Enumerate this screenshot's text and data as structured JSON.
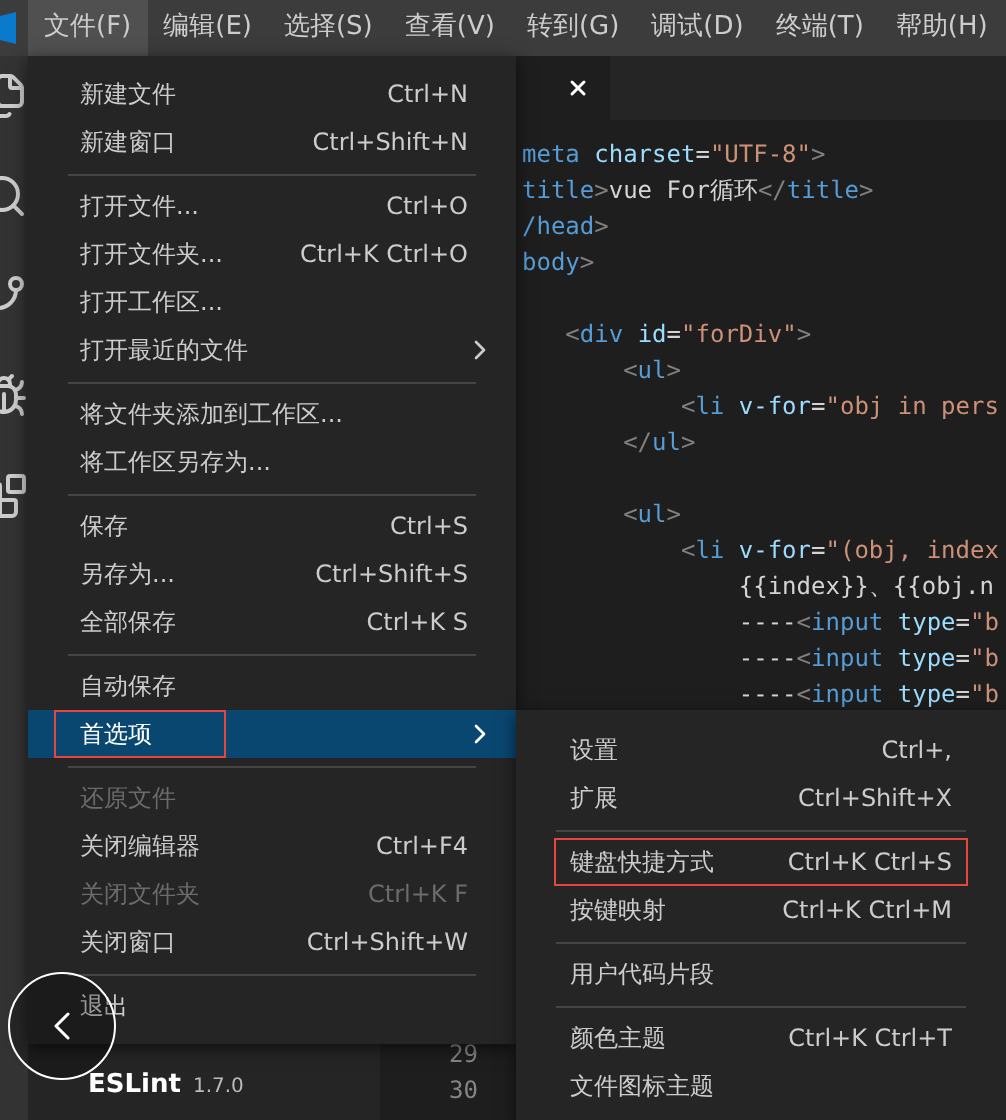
{
  "menu_bar": [
    {
      "label": "文件(F)",
      "selected": true
    },
    {
      "label": "编辑(E)",
      "selected": false
    },
    {
      "label": "选择(S)",
      "selected": false
    },
    {
      "label": "查看(V)",
      "selected": false
    },
    {
      "label": "转到(G)",
      "selected": false
    },
    {
      "label": "调试(D)",
      "selected": false
    },
    {
      "label": "终端(T)",
      "selected": false
    },
    {
      "label": "帮助(H)",
      "selected": false
    }
  ],
  "editor": {
    "lines": [
      {
        "kind": "code",
        "tokens": [
          {
            "kind": "tag",
            "text": "meta"
          },
          {
            "kind": "attr",
            "text": " charset"
          },
          {
            "kind": "text",
            "text": "="
          },
          {
            "kind": "string",
            "text": "\"UTF-8\""
          },
          {
            "kind": "punct",
            "text": ">"
          }
        ]
      },
      {
        "kind": "code",
        "tokens": [
          {
            "kind": "tag",
            "text": "title"
          },
          {
            "kind": "punct",
            "text": ">"
          },
          {
            "kind": "text",
            "text": "vue For循环"
          },
          {
            "kind": "punct",
            "text": "</"
          },
          {
            "kind": "tag",
            "text": "title"
          },
          {
            "kind": "punct",
            "text": ">"
          }
        ]
      },
      {
        "kind": "code",
        "tokens": [
          {
            "kind": "tag",
            "text": "/head"
          },
          {
            "kind": "punct",
            "text": ">"
          }
        ]
      },
      {
        "kind": "code",
        "tokens": [
          {
            "kind": "tag",
            "text": "body"
          },
          {
            "kind": "punct",
            "text": ">"
          }
        ]
      },
      {
        "kind": "blank"
      },
      {
        "kind": "code",
        "tokens": [
          {
            "kind": "punct",
            "text": "   <"
          },
          {
            "kind": "tag",
            "text": "div"
          },
          {
            "kind": "attr",
            "text": " id"
          },
          {
            "kind": "text",
            "text": "="
          },
          {
            "kind": "string",
            "text": "\"forDiv\""
          },
          {
            "kind": "punct",
            "text": ">"
          }
        ]
      },
      {
        "kind": "code",
        "tokens": [
          {
            "kind": "punct",
            "text": "       <"
          },
          {
            "kind": "tag",
            "text": "ul"
          },
          {
            "kind": "punct",
            "text": ">"
          }
        ]
      },
      {
        "kind": "code",
        "tokens": [
          {
            "kind": "punct",
            "text": "           <"
          },
          {
            "kind": "tag",
            "text": "li"
          },
          {
            "kind": "attr",
            "text": " v-for"
          },
          {
            "kind": "text",
            "text": "="
          },
          {
            "kind": "string",
            "text": "\"obj in pers"
          }
        ]
      },
      {
        "kind": "code",
        "tokens": [
          {
            "kind": "punct",
            "text": "       </"
          },
          {
            "kind": "tag",
            "text": "ul"
          },
          {
            "kind": "punct",
            "text": ">"
          }
        ]
      },
      {
        "kind": "blank"
      },
      {
        "kind": "code",
        "tokens": [
          {
            "kind": "punct",
            "text": "       <"
          },
          {
            "kind": "tag",
            "text": "ul"
          },
          {
            "kind": "punct",
            "text": ">"
          }
        ]
      },
      {
        "kind": "code",
        "tokens": [
          {
            "kind": "punct",
            "text": "           <"
          },
          {
            "kind": "tag",
            "text": "li"
          },
          {
            "kind": "attr",
            "text": " v-for"
          },
          {
            "kind": "text",
            "text": "="
          },
          {
            "kind": "string",
            "text": "\"(obj, index"
          }
        ]
      },
      {
        "kind": "code",
        "tokens": [
          {
            "kind": "text",
            "text": "               {{index}}、{{obj.n"
          }
        ]
      },
      {
        "kind": "code",
        "tokens": [
          {
            "kind": "text",
            "text": "               ----"
          },
          {
            "kind": "punct",
            "text": "<"
          },
          {
            "kind": "tag",
            "text": "input"
          },
          {
            "kind": "attr",
            "text": " type"
          },
          {
            "kind": "text",
            "text": "="
          },
          {
            "kind": "string",
            "text": "\"b"
          }
        ]
      },
      {
        "kind": "code",
        "tokens": [
          {
            "kind": "text",
            "text": "               ----"
          },
          {
            "kind": "punct",
            "text": "<"
          },
          {
            "kind": "tag",
            "text": "input"
          },
          {
            "kind": "attr",
            "text": " type"
          },
          {
            "kind": "text",
            "text": "="
          },
          {
            "kind": "string",
            "text": "\"b"
          }
        ]
      },
      {
        "kind": "code",
        "tokens": [
          {
            "kind": "text",
            "text": "               ----"
          },
          {
            "kind": "punct",
            "text": "<"
          },
          {
            "kind": "tag",
            "text": "input"
          },
          {
            "kind": "attr",
            "text": " type"
          },
          {
            "kind": "text",
            "text": "="
          },
          {
            "kind": "string",
            "text": "\"b"
          }
        ]
      }
    ],
    "line_numbers": [
      "29",
      "30"
    ]
  },
  "extensions": [
    {
      "name": "ESLint",
      "version": "1.7.0"
    }
  ],
  "file_menu": [
    {
      "kind": "item",
      "label": "新建文件",
      "shortcut": "Ctrl+N",
      "disabled": false,
      "selected": false,
      "submenu": false,
      "outlined": false
    },
    {
      "kind": "item",
      "label": "新建窗口",
      "shortcut": "Ctrl+Shift+N",
      "disabled": false,
      "selected": false,
      "submenu": false,
      "outlined": false
    },
    {
      "kind": "separator"
    },
    {
      "kind": "item",
      "label": "打开文件...",
      "shortcut": "Ctrl+O",
      "disabled": false,
      "selected": false,
      "submenu": false,
      "outlined": false
    },
    {
      "kind": "item",
      "label": "打开文件夹...",
      "shortcut": "Ctrl+K Ctrl+O",
      "disabled": false,
      "selected": false,
      "submenu": false,
      "outlined": false
    },
    {
      "kind": "item",
      "label": "打开工作区...",
      "disabled": false,
      "selected": false,
      "submenu": false,
      "outlined": false
    },
    {
      "kind": "item",
      "label": "打开最近的文件",
      "disabled": false,
      "selected": false,
      "submenu": true,
      "outlined": false
    },
    {
      "kind": "separator"
    },
    {
      "kind": "item",
      "label": "将文件夹添加到工作区...",
      "disabled": false,
      "selected": false,
      "submenu": false,
      "outlined": false
    },
    {
      "kind": "item",
      "label": "将工作区另存为...",
      "disabled": false,
      "selected": false,
      "submenu": false,
      "outlined": false
    },
    {
      "kind": "separator"
    },
    {
      "kind": "item",
      "label": "保存",
      "shortcut": "Ctrl+S",
      "disabled": false,
      "selected": false,
      "submenu": false,
      "outlined": false
    },
    {
      "kind": "item",
      "label": "另存为...",
      "shortcut": "Ctrl+Shift+S",
      "disabled": false,
      "selected": false,
      "submenu": false,
      "outlined": false
    },
    {
      "kind": "item",
      "label": "全部保存",
      "shortcut": "Ctrl+K S",
      "disabled": false,
      "selected": false,
      "submenu": false,
      "outlined": false
    },
    {
      "kind": "separator"
    },
    {
      "kind": "item",
      "label": "自动保存",
      "disabled": false,
      "selected": false,
      "submenu": false,
      "outlined": false
    },
    {
      "kind": "item",
      "label": "首选项",
      "disabled": false,
      "selected": true,
      "submenu": true,
      "outlined": true
    },
    {
      "kind": "separator"
    },
    {
      "kind": "item",
      "label": "还原文件",
      "disabled": true,
      "selected": false,
      "submenu": false,
      "outlined": false
    },
    {
      "kind": "item",
      "label": "关闭编辑器",
      "shortcut": "Ctrl+F4",
      "disabled": false,
      "selected": false,
      "submenu": false,
      "outlined": false
    },
    {
      "kind": "item",
      "label": "关闭文件夹",
      "shortcut": "Ctrl+K F",
      "disabled": true,
      "selected": false,
      "submenu": false,
      "outlined": false
    },
    {
      "kind": "item",
      "label": "关闭窗口",
      "shortcut": "Ctrl+Shift+W",
      "disabled": false,
      "selected": false,
      "submenu": false,
      "outlined": false
    },
    {
      "kind": "separator"
    },
    {
      "kind": "item",
      "label": "退出",
      "disabled": false,
      "selected": false,
      "submenu": false,
      "outlined": false
    }
  ],
  "preferences_submenu": [
    {
      "kind": "item",
      "label": "设置",
      "shortcut": "Ctrl+,",
      "outlined": false
    },
    {
      "kind": "item",
      "label": "扩展",
      "shortcut": "Ctrl+Shift+X",
      "outlined": false
    },
    {
      "kind": "separator"
    },
    {
      "kind": "item",
      "label": "键盘快捷方式",
      "shortcut": "Ctrl+K Ctrl+S",
      "outlined": true
    },
    {
      "kind": "item",
      "label": "按键映射",
      "shortcut": "Ctrl+K Ctrl+M",
      "outlined": false
    },
    {
      "kind": "separator"
    },
    {
      "kind": "item",
      "label": "用户代码片段",
      "outlined": false
    },
    {
      "kind": "separator"
    },
    {
      "kind": "item",
      "label": "颜色主题",
      "shortcut": "Ctrl+K Ctrl+T",
      "outlined": false
    },
    {
      "kind": "item",
      "label": "文件图标主题",
      "outlined": false
    }
  ]
}
